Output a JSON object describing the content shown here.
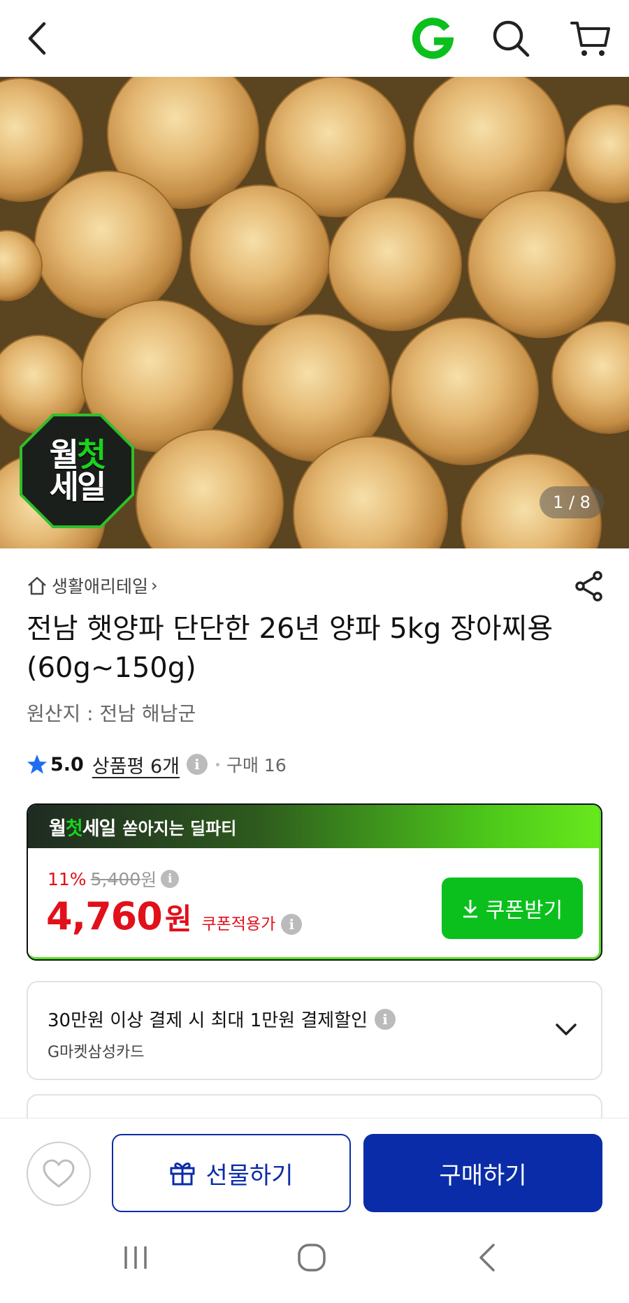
{
  "header": {
    "back_icon": "chevron-left-icon",
    "logo_icon": "gmarket-g-logo-icon",
    "search_icon": "search-icon",
    "cart_icon": "cart-icon"
  },
  "hero": {
    "badge": {
      "line1_a": "월",
      "line1_b": "첫",
      "line2": "세일"
    },
    "counter": "1 / 8"
  },
  "product": {
    "store_name": "생활애리테일",
    "store_chevron": "›",
    "title": "전남 햇양파 단단한 26년 양파 5kg 장아찌용(60g~150g)",
    "origin": "원산지 : 전남 해남군",
    "rating": "5.0",
    "reviews": "상품평 6개",
    "purchases": "구매 16"
  },
  "deal": {
    "logo_a": "월",
    "logo_b": "첫",
    "logo_c": "세일",
    "subtitle": "쏟아지는 딜파티",
    "discount": "11%",
    "original_price": "5,400",
    "original_unit": "원",
    "price": "4,760",
    "price_unit": "원",
    "price_note": "쿠폰적용가",
    "coupon_button": "쿠폰받기"
  },
  "card_benefit": {
    "title": "30만원 이상 결제 시 최대 1만원 결제할인",
    "card_name": "G마켓삼성카드"
  },
  "bottom_bar": {
    "gift_label": "선물하기",
    "buy_label": "구매하기"
  },
  "colors": {
    "accent_green": "#0bc01d",
    "price_red": "#e1101a",
    "brand_blue": "#0b2ca8"
  }
}
